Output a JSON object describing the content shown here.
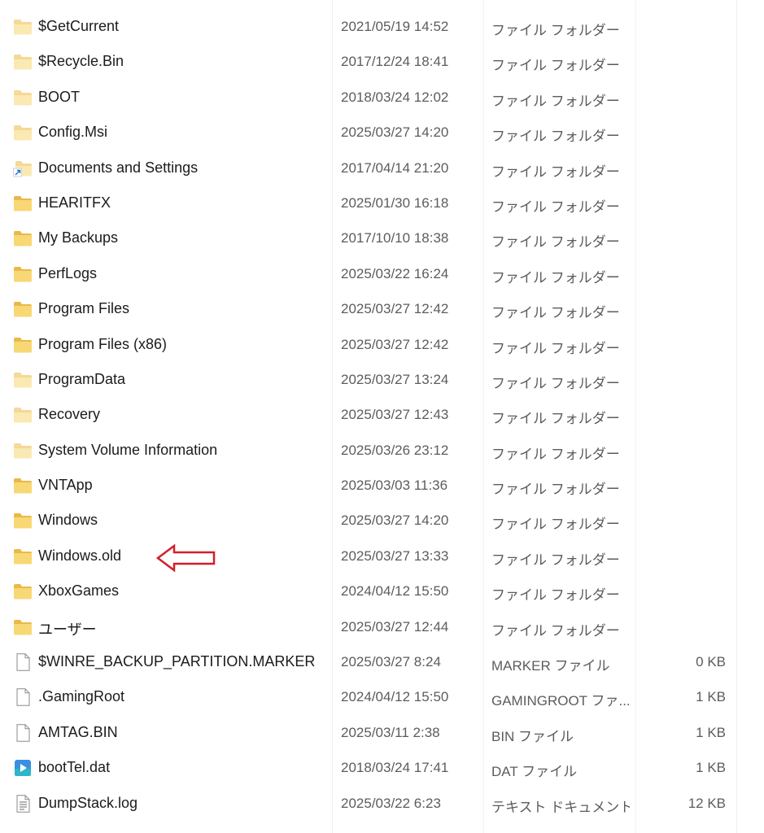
{
  "columns": {
    "name": "",
    "date": "",
    "type": "",
    "size": ""
  },
  "colors": {
    "folder": "#f8d775",
    "folder_dark": "#e9b949",
    "file_outline": "#8a8a8a",
    "annotation_arrow": "#d0202a"
  },
  "annotation": {
    "icon": "red-outline-left-arrow",
    "points_to": "Windows.old"
  },
  "files": [
    {
      "name": "$GetCurrent",
      "date": "2021/05/19 14:52",
      "type": "ファイル フォルダー",
      "size": "",
      "icon": "folder-icon-faded"
    },
    {
      "name": "$Recycle.Bin",
      "date": "2017/12/24 18:41",
      "type": "ファイル フォルダー",
      "size": "",
      "icon": "folder-icon-faded"
    },
    {
      "name": "BOOT",
      "date": "2018/03/24 12:02",
      "type": "ファイル フォルダー",
      "size": "",
      "icon": "folder-icon-faded"
    },
    {
      "name": "Config.Msi",
      "date": "2025/03/27 14:20",
      "type": "ファイル フォルダー",
      "size": "",
      "icon": "folder-icon-faded"
    },
    {
      "name": "Documents and Settings",
      "date": "2017/04/14 21:20",
      "type": "ファイル フォルダー",
      "size": "",
      "icon": "shortcut-folder-icon"
    },
    {
      "name": "HEARITFX",
      "date": "2025/01/30 16:18",
      "type": "ファイル フォルダー",
      "size": "",
      "icon": "folder-icon"
    },
    {
      "name": "My Backups",
      "date": "2017/10/10 18:38",
      "type": "ファイル フォルダー",
      "size": "",
      "icon": "folder-icon"
    },
    {
      "name": "PerfLogs",
      "date": "2025/03/22 16:24",
      "type": "ファイル フォルダー",
      "size": "",
      "icon": "folder-icon"
    },
    {
      "name": "Program Files",
      "date": "2025/03/27 12:42",
      "type": "ファイル フォルダー",
      "size": "",
      "icon": "folder-icon"
    },
    {
      "name": "Program Files (x86)",
      "date": "2025/03/27 12:42",
      "type": "ファイル フォルダー",
      "size": "",
      "icon": "folder-icon"
    },
    {
      "name": "ProgramData",
      "date": "2025/03/27 13:24",
      "type": "ファイル フォルダー",
      "size": "",
      "icon": "folder-icon-faded"
    },
    {
      "name": "Recovery",
      "date": "2025/03/27 12:43",
      "type": "ファイル フォルダー",
      "size": "",
      "icon": "folder-icon-faded"
    },
    {
      "name": "System Volume Information",
      "date": "2025/03/26 23:12",
      "type": "ファイル フォルダー",
      "size": "",
      "icon": "folder-icon-faded"
    },
    {
      "name": "VNTApp",
      "date": "2025/03/03 11:36",
      "type": "ファイル フォルダー",
      "size": "",
      "icon": "folder-icon"
    },
    {
      "name": "Windows",
      "date": "2025/03/27 14:20",
      "type": "ファイル フォルダー",
      "size": "",
      "icon": "folder-icon"
    },
    {
      "name": "Windows.old",
      "date": "2025/03/27 13:33",
      "type": "ファイル フォルダー",
      "size": "",
      "icon": "folder-icon"
    },
    {
      "name": "XboxGames",
      "date": "2024/04/12 15:50",
      "type": "ファイル フォルダー",
      "size": "",
      "icon": "folder-icon"
    },
    {
      "name": "ユーザー",
      "date": "2025/03/27 12:44",
      "type": "ファイル フォルダー",
      "size": "",
      "icon": "folder-icon"
    },
    {
      "name": "$WINRE_BACKUP_PARTITION.MARKER",
      "date": "2025/03/27 8:24",
      "type": "MARKER ファイル",
      "size": "0 KB",
      "icon": "file-icon"
    },
    {
      "name": ".GamingRoot",
      "date": "2024/04/12 15:50",
      "type": "GAMINGROOT ファ...",
      "size": "1 KB",
      "icon": "file-icon"
    },
    {
      "name": "AMTAG.BIN",
      "date": "2025/03/11 2:38",
      "type": "BIN ファイル",
      "size": "1 KB",
      "icon": "file-icon"
    },
    {
      "name": "bootTel.dat",
      "date": "2018/03/24 17:41",
      "type": "DAT ファイル",
      "size": "1 KB",
      "icon": "media-file-icon"
    },
    {
      "name": "DumpStack.log",
      "date": "2025/03/22 6:23",
      "type": "テキスト ドキュメント",
      "size": "12 KB",
      "icon": "text-file-icon"
    }
  ]
}
